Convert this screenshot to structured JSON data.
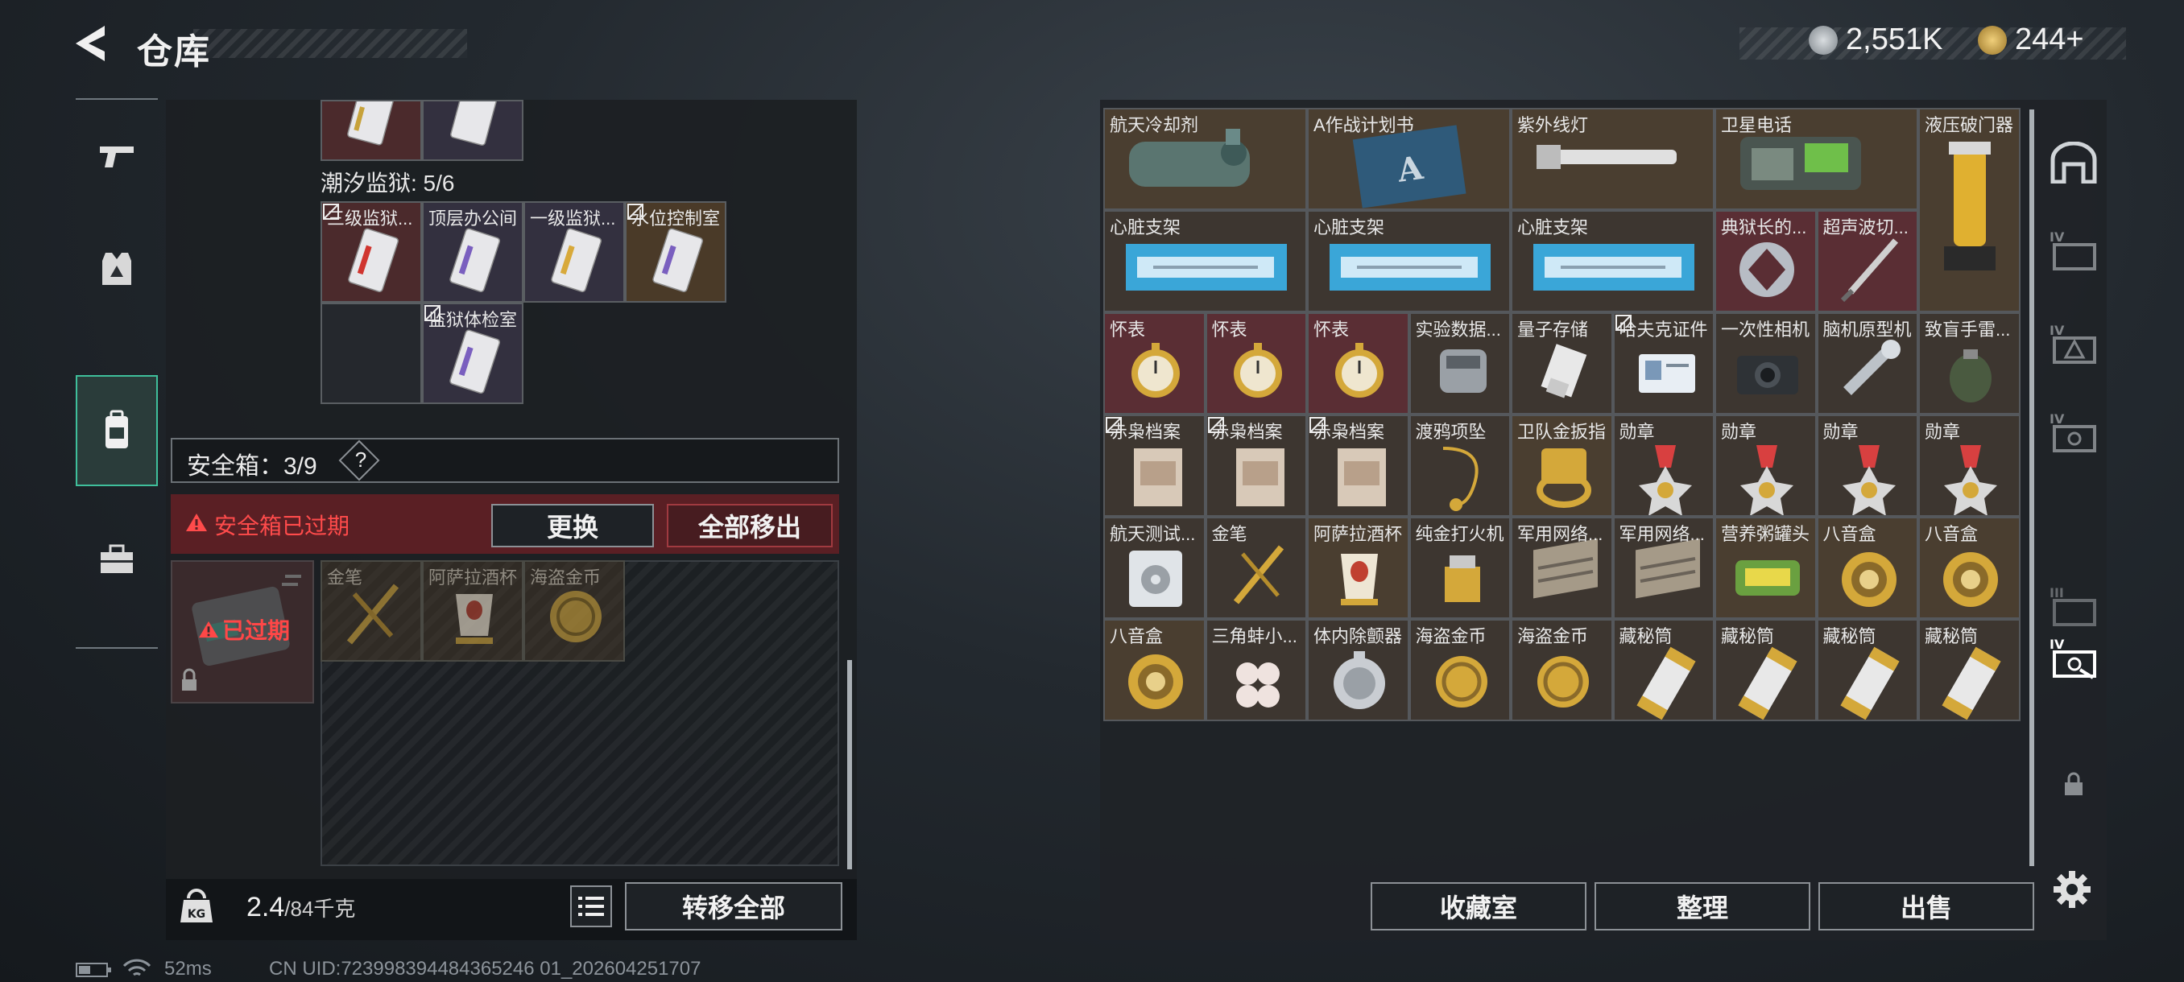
{
  "header": {
    "title": "仓库",
    "currency1": "2,551K",
    "currency2": "244+"
  },
  "colors": {
    "accent": "#3fbf9b",
    "warning": "#ff4b4b",
    "gold": "#c9a23c"
  },
  "nav": {
    "items": [
      {
        "icon": "pistol-icon"
      },
      {
        "icon": "armor-vest-icon"
      },
      {
        "icon": "backpack-icon",
        "active": true
      },
      {
        "icon": "toolbox-icon"
      }
    ]
  },
  "left": {
    "section_label": "潮汐监狱: 5/6",
    "keycards": [
      "三级监狱...",
      "顶层办公间",
      "一级监狱...",
      "水位控制室",
      "监狱体检室"
    ],
    "safe_title": "安全箱：3/9",
    "safe_help": "?",
    "warning": "安全箱已过期",
    "replace_button": "更换",
    "remove_all_button": "全部移出",
    "expired_label": "已过期",
    "safe_items": [
      "金笔",
      "阿萨拉酒杯",
      "海盗金币"
    ],
    "weight_value": "2.4",
    "weight_max": "/84千克",
    "transfer_all_button": "转移全部"
  },
  "status": {
    "ping": "52ms",
    "uid": "CN UID:723998394484365246 01_202604251707"
  },
  "right": {
    "rows": [
      [
        "航天冷却剂",
        "A作战计划书",
        "紫外线灯",
        "卫星电话",
        "液压破门器"
      ],
      [
        "心脏支架",
        "心脏支架",
        "心脏支架",
        "典狱长的...",
        "超声波切..."
      ],
      [
        "怀表",
        "怀表",
        "怀表",
        "实验数据...",
        "量子存储",
        "哈夫克证件",
        "一次性相机",
        "脑机原型机",
        "致盲手雷..."
      ],
      [
        "赤枭档案",
        "赤枭档案",
        "赤枭档案",
        "渡鸦项坠",
        "卫队金扳指",
        "勋章",
        "勋章",
        "勋章",
        "勋章"
      ],
      [
        "航天测试...",
        "金笔",
        "阿萨拉酒杯",
        "纯金打火机",
        "军用网络...",
        "军用网络...",
        "营养粥罐头",
        "八音盒",
        "八音盒"
      ],
      [
        "八音盒",
        "三角蚌小...",
        "体内除颤器",
        "海盗金币",
        "海盗金币",
        "藏秘筒",
        "藏秘筒",
        "藏秘筒",
        "藏秘筒"
      ]
    ],
    "collection_button": "收藏室",
    "sort_button": "整理",
    "sell_button": "出售"
  }
}
